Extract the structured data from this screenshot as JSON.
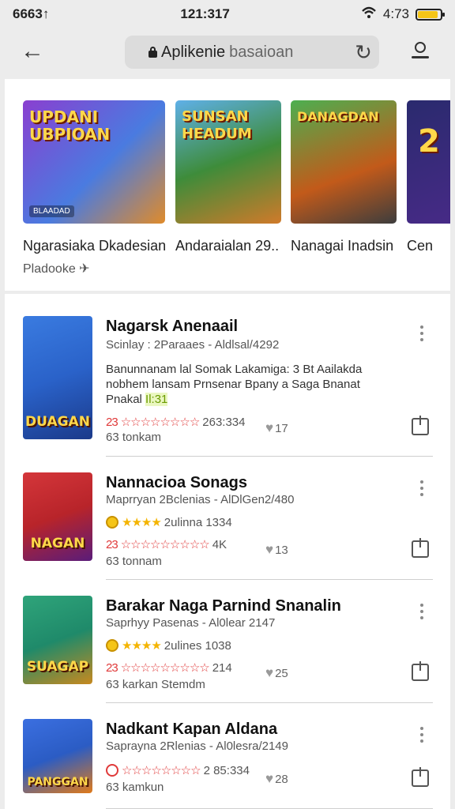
{
  "status_bar": {
    "left": "6663↑",
    "time": "121:317",
    "right": "4:73",
    "battery_level": 0.9
  },
  "toolbar": {
    "back_icon": "back-arrow-icon",
    "url_host": "Aplikenie",
    "url_rest": "basaioan",
    "reload_icon": "reload-icon",
    "account_icon": "account-icon"
  },
  "featured": {
    "items": [
      {
        "title": "Ngarasiaka Dkadesian",
        "subtitle": "Pladooke ✈",
        "logo": "UPDANI\nUBPIOAN",
        "badge": "BLAADAD",
        "bg": "#7a3fbf"
      },
      {
        "title": "Andaraialan 29..",
        "subtitle": "",
        "logo": "SUNSAN\nHEADUM",
        "badge": "",
        "bg": "#3e8c3a"
      },
      {
        "title": "Nanagai Inadsin",
        "subtitle": "",
        "logo": "DANAGDAN",
        "badge": "",
        "bg": "#c25a1a"
      },
      {
        "title": "Cen",
        "subtitle": "",
        "logo": "2",
        "badge": "",
        "bg": "#2a2a6e"
      }
    ]
  },
  "apps": [
    {
      "name": "Nagarsk Anenaail",
      "meta": "Scinlay : 2Paraaes - Aldlsal/4292",
      "desc_pre": "Banunnanam lal Somak Lakamiga: 3 Bt Aailakda nobhem lansam Prnsenar Bpany a Saga Bnanat Pnakal ",
      "desc_hl": "Il:31",
      "star_prefix": "23",
      "star_count": "263:334",
      "count_text": "63 tonkam",
      "likes": "17",
      "icon_text": "DUAGAN",
      "icon_bg": "#2a62c9"
    },
    {
      "name": "Nannacioa Sonags",
      "meta": "Maprryan 2Bclenias - AlDlGen2/480",
      "gold_text": "2ulinna 1334",
      "star_prefix": "23",
      "star_count": "4K",
      "count_text": "63 tonnam",
      "likes": "13",
      "icon_text": "NAGAN",
      "icon_bg": "#b8242a"
    },
    {
      "name": "Barakar Naga Parnind Snanalin",
      "meta": "Saprhyy Pasenas - Al0lear 2147",
      "gold_text": "2ulines 1038",
      "star_prefix": "23",
      "star_count": "214",
      "count_text": "63 karkan Stemdm",
      "likes": "25",
      "icon_text": "SUAGAP",
      "icon_bg": "#1f8a6a"
    },
    {
      "name": "Nadkant Kapan Aldana",
      "meta": "Saprayna 2Rlenias - Al0lesra/2149",
      "star_prefix": "",
      "star_count": "2 85:334",
      "count_text": "63 kamkun",
      "likes": "28",
      "icon_text": "PANGGAN",
      "icon_bg": "#2b5cc4"
    }
  ]
}
